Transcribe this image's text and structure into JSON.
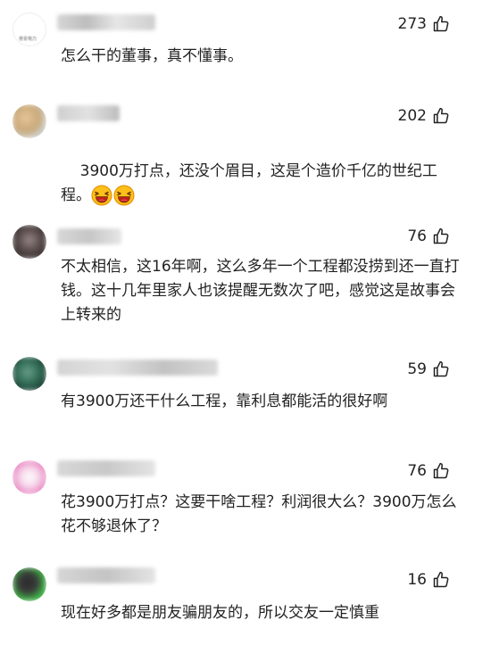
{
  "comments": [
    {
      "likes": "273",
      "text": "怎么干的董事，真不懂事。",
      "avatar_caption": "普安电力"
    },
    {
      "likes": "202",
      "text": "3900万打点，还没个眉目，这是个造价千亿的世纪工程。"
    },
    {
      "likes": "76",
      "text": "不太相信，这16年啊，这么多年一个工程都没捞到还一直打钱。这十几年里家人也该提醒无数次了吧，感觉这是故事会上转来的"
    },
    {
      "likes": "59",
      "text": "有3900万还干什么工程，靠利息都能活的很好啊"
    },
    {
      "likes": "76",
      "text": "花3900万打点？这要干啥工程？利润很大么？3900万怎么花不够退休了？"
    },
    {
      "likes": "16",
      "text": "现在好多都是朋友骗朋友的，所以交友一定慎重"
    }
  ],
  "icons": {
    "like": "thumbs-up-outline-icon",
    "emoji": "laughing-emoji-icon"
  },
  "colors": {
    "text": "#222222",
    "blur_gray": "#d9d9d9"
  }
}
